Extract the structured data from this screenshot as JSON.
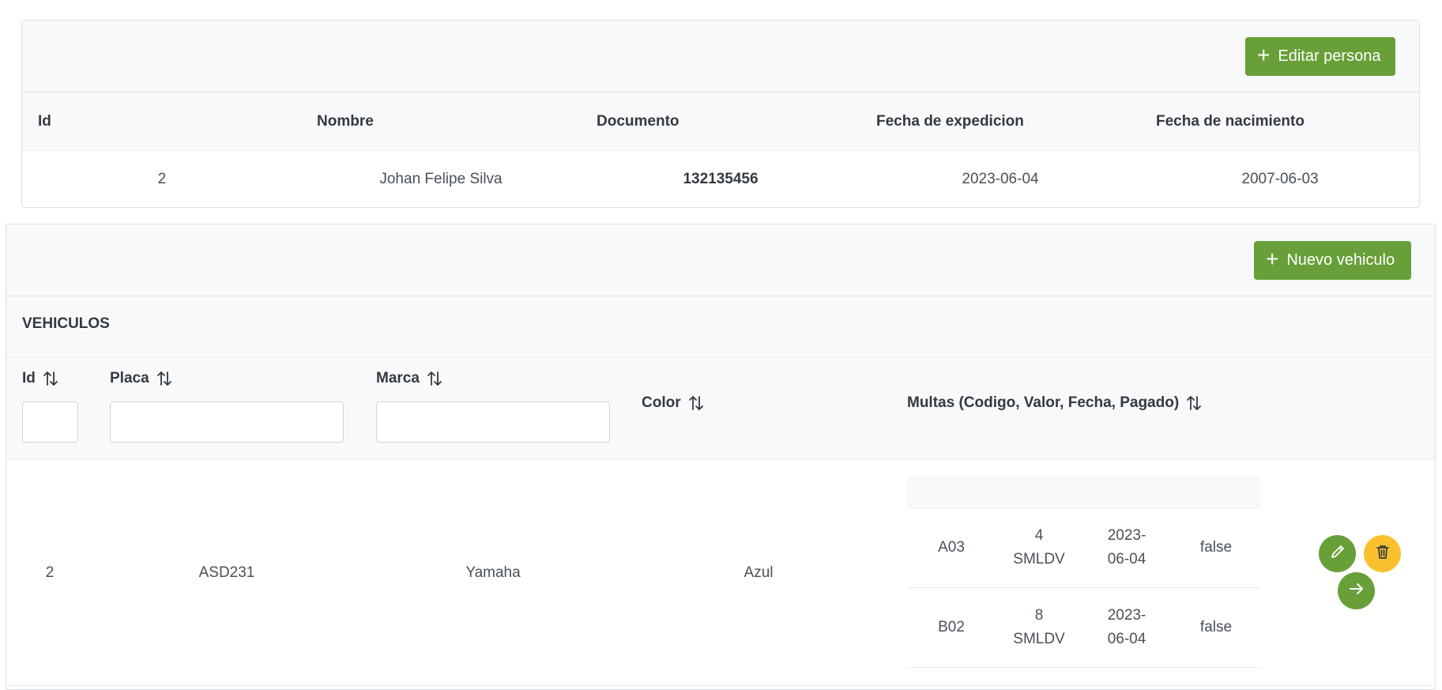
{
  "person": {
    "edit_button_label": "Editar persona",
    "columns": [
      "Id",
      "Nombre",
      "Documento",
      "Fecha de expedicion",
      "Fecha de nacimiento"
    ],
    "row": {
      "id": "2",
      "nombre": "Johan Felipe Silva",
      "documento": "132135456",
      "fecha_expedicion": "2023-06-04",
      "fecha_nacimiento": "2007-06-03"
    }
  },
  "vehicles": {
    "new_button_label": "Nuevo vehiculo",
    "title": "VEHICULOS",
    "columns": {
      "id": "Id",
      "placa": "Placa",
      "marca": "Marca",
      "color": "Color",
      "multas": "Multas (Codigo, Valor, Fecha, Pagado)"
    },
    "filters": {
      "id": "",
      "placa": "",
      "marca": ""
    },
    "rows": [
      {
        "id": "2",
        "placa": "ASD231",
        "marca": "Yamaha",
        "color": "Azul",
        "multas": [
          {
            "codigo": "A03",
            "valor_line1": "4",
            "valor_line2": "SMLDV",
            "fecha_line1": "2023-",
            "fecha_line2": "06-04",
            "pagado": "false"
          },
          {
            "codigo": "B02",
            "valor_line1": "8",
            "valor_line2": "SMLDV",
            "fecha_line1": "2023-",
            "fecha_line2": "06-04",
            "pagado": "false"
          }
        ]
      }
    ]
  },
  "icons": {
    "plus": "plus-icon",
    "sort": "sort-icon",
    "edit": "pencil-icon",
    "delete": "trash-icon",
    "go": "arrow-right-icon"
  },
  "colors": {
    "primary_green": "#689f38",
    "warning_yellow": "#fbc02d",
    "header_bg": "#f8f9fa",
    "border": "#dee2e6"
  }
}
